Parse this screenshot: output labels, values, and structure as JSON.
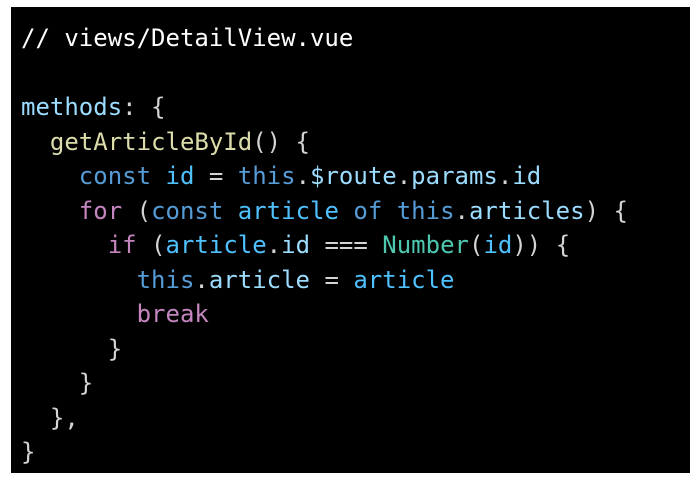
{
  "editor": {
    "filename_comment": "// views/DetailView.vue",
    "colors": {
      "background": "#000000",
      "text": "#ffffff",
      "plain": "#d4d4d4",
      "property": "#9cdcfe",
      "function": "#dcdcaa",
      "keyword_blue": "#569cd6",
      "variable": "#4fc1ff",
      "control_keyword": "#c586c0",
      "type": "#4ec9b0"
    },
    "lines": [
      [
        {
          "t": "// views/DetailView.vue",
          "c": "text"
        }
      ],
      [],
      [
        {
          "t": "methods",
          "c": "property"
        },
        {
          "t": ": {",
          "c": "plain"
        }
      ],
      [
        {
          "t": "  ",
          "c": "plain"
        },
        {
          "t": "getArticleById",
          "c": "function"
        },
        {
          "t": "() {",
          "c": "plain"
        }
      ],
      [
        {
          "t": "    ",
          "c": "plain"
        },
        {
          "t": "const",
          "c": "keyword_blue"
        },
        {
          "t": " ",
          "c": "plain"
        },
        {
          "t": "id",
          "c": "variable"
        },
        {
          "t": " = ",
          "c": "plain"
        },
        {
          "t": "this",
          "c": "keyword_blue"
        },
        {
          "t": ".",
          "c": "plain"
        },
        {
          "t": "$route",
          "c": "property"
        },
        {
          "t": ".",
          "c": "plain"
        },
        {
          "t": "params",
          "c": "property"
        },
        {
          "t": ".",
          "c": "plain"
        },
        {
          "t": "id",
          "c": "property"
        }
      ],
      [
        {
          "t": "    ",
          "c": "plain"
        },
        {
          "t": "for",
          "c": "control_keyword"
        },
        {
          "t": " (",
          "c": "plain"
        },
        {
          "t": "const",
          "c": "keyword_blue"
        },
        {
          "t": " ",
          "c": "plain"
        },
        {
          "t": "article",
          "c": "variable"
        },
        {
          "t": " ",
          "c": "plain"
        },
        {
          "t": "of",
          "c": "keyword_blue"
        },
        {
          "t": " ",
          "c": "plain"
        },
        {
          "t": "this",
          "c": "keyword_blue"
        },
        {
          "t": ".",
          "c": "plain"
        },
        {
          "t": "articles",
          "c": "property"
        },
        {
          "t": ") {",
          "c": "plain"
        }
      ],
      [
        {
          "t": "      ",
          "c": "plain"
        },
        {
          "t": "if",
          "c": "control_keyword"
        },
        {
          "t": " (",
          "c": "plain"
        },
        {
          "t": "article",
          "c": "variable"
        },
        {
          "t": ".",
          "c": "plain"
        },
        {
          "t": "id",
          "c": "property"
        },
        {
          "t": " === ",
          "c": "plain"
        },
        {
          "t": "Number",
          "c": "type"
        },
        {
          "t": "(",
          "c": "plain"
        },
        {
          "t": "id",
          "c": "variable"
        },
        {
          "t": ")) {",
          "c": "plain"
        }
      ],
      [
        {
          "t": "        ",
          "c": "plain"
        },
        {
          "t": "this",
          "c": "keyword_blue"
        },
        {
          "t": ".",
          "c": "plain"
        },
        {
          "t": "article",
          "c": "property"
        },
        {
          "t": " = ",
          "c": "plain"
        },
        {
          "t": "article",
          "c": "variable"
        }
      ],
      [
        {
          "t": "        ",
          "c": "plain"
        },
        {
          "t": "break",
          "c": "control_keyword"
        }
      ],
      [
        {
          "t": "      }",
          "c": "plain"
        }
      ],
      [
        {
          "t": "    }",
          "c": "plain"
        }
      ],
      [
        {
          "t": "  },",
          "c": "plain"
        }
      ],
      [
        {
          "t": "}",
          "c": "plain"
        }
      ]
    ]
  }
}
